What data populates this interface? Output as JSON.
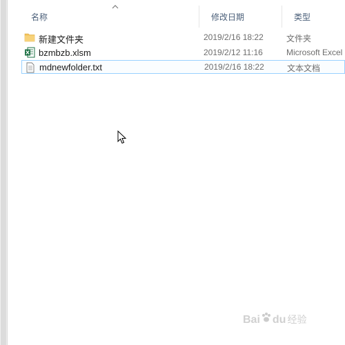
{
  "columns": {
    "name": "名称",
    "date_modified": "修改日期",
    "type": "类型"
  },
  "files": [
    {
      "name": "新建文件夹",
      "date": "2019/2/16 18:22",
      "type": "文件夹",
      "icon": "folder-icon"
    },
    {
      "name": "bzmbzb.xlsm",
      "date": "2019/2/12 11:16",
      "type": "Microsoft Excel",
      "icon": "excel-file-icon"
    },
    {
      "name": "mdnewfolder.txt",
      "date": "2019/2/16 18:22",
      "type": "文本文档",
      "icon": "text-file-icon"
    }
  ],
  "watermark": {
    "left": "Bai",
    "right": "du",
    "sub": "经验"
  },
  "colors": {
    "header_text": "#4c607a",
    "selection_border": "#99d1ff",
    "folder": "#f2c25b",
    "excel": "#1e7145"
  }
}
